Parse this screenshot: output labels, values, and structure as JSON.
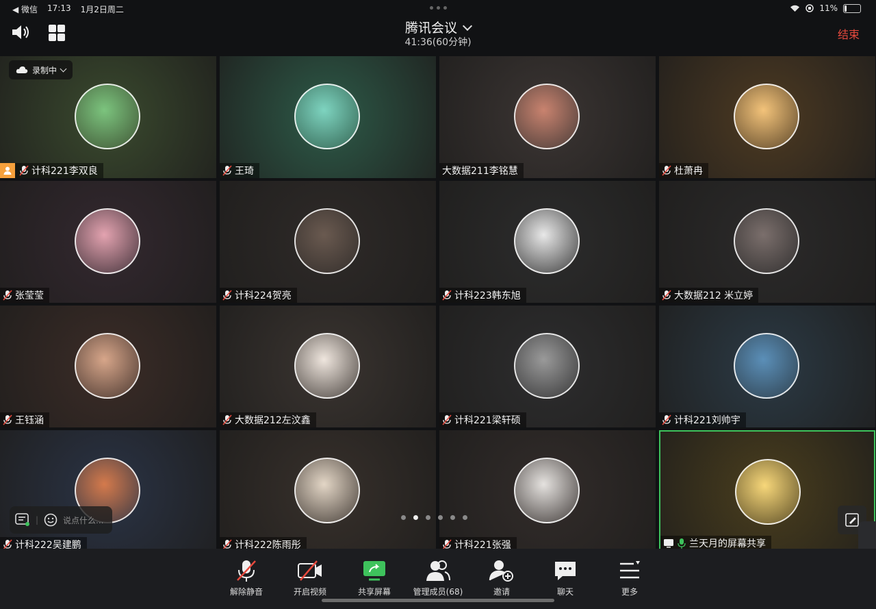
{
  "status": {
    "app": "◀ 微信",
    "time": "17:13",
    "date": "1月2日周二",
    "battery": "11%"
  },
  "header": {
    "title": "腾讯会议",
    "elapsed": "41:36(60分钟)",
    "end_label": "结束"
  },
  "recording": {
    "label": "录制中"
  },
  "tiles": [
    {
      "name": "计科221李双良",
      "bg": "#3a4a2e",
      "av": "#7cc47e"
    },
    {
      "name": "王琦",
      "bg": "#2d5a48",
      "av": "#7ed4c0"
    },
    {
      "name": "大数据211李铭慧",
      "bg": "#3b3533",
      "av": "#c9836f"
    },
    {
      "name": "杜萧冉",
      "bg": "#4d3a22",
      "av": "#f3c37a"
    },
    {
      "name": "张莹莹",
      "bg": "#33282f",
      "av": "#e3a3b0"
    },
    {
      "name": "计科224贺亮",
      "bg": "#2e2a28",
      "av": "#6a5a50"
    },
    {
      "name": "计科223韩东旭",
      "bg": "#2c2c2c",
      "av": "#e8e8e8"
    },
    {
      "name": "大数据212 米立婷",
      "bg": "#2b2a2a",
      "av": "#7b6f6c"
    },
    {
      "name": "王钰涵",
      "bg": "#3b2c27",
      "av": "#d7a68a"
    },
    {
      "name": "大数据212左汶鑫",
      "bg": "#3a3430",
      "av": "#efe6de"
    },
    {
      "name": "计科221梁轩硕",
      "bg": "#2d2d2e",
      "av": "#9a9a9a"
    },
    {
      "name": "计科221刘帅宇",
      "bg": "#2b3a45",
      "av": "#5b8fb8"
    },
    {
      "name": "计科222吴建鹏",
      "bg": "#2a3345",
      "av": "#d47a4c"
    },
    {
      "name": "计科222陈雨彤",
      "bg": "#37302b",
      "av": "#e3d6c6"
    },
    {
      "name": "计科221张强",
      "bg": "#322c2a",
      "av": "#e5e2df"
    },
    {
      "name": "兰天月的屏幕共享",
      "bg": "#4a3e1d",
      "av": "#f7d77a"
    }
  ],
  "chat": {
    "placeholder": "说点什么..."
  },
  "toolbar": [
    {
      "label": "解除静音",
      "icon": "mic-muted-icon"
    },
    {
      "label": "开启视频",
      "icon": "video-off-icon"
    },
    {
      "label": "共享屏幕",
      "icon": "share-screen-icon"
    },
    {
      "label": "管理成员(68)",
      "icon": "members-icon"
    },
    {
      "label": "邀请",
      "icon": "invite-icon"
    },
    {
      "label": "聊天",
      "icon": "chat-icon"
    },
    {
      "label": "更多",
      "icon": "more-icon"
    }
  ]
}
